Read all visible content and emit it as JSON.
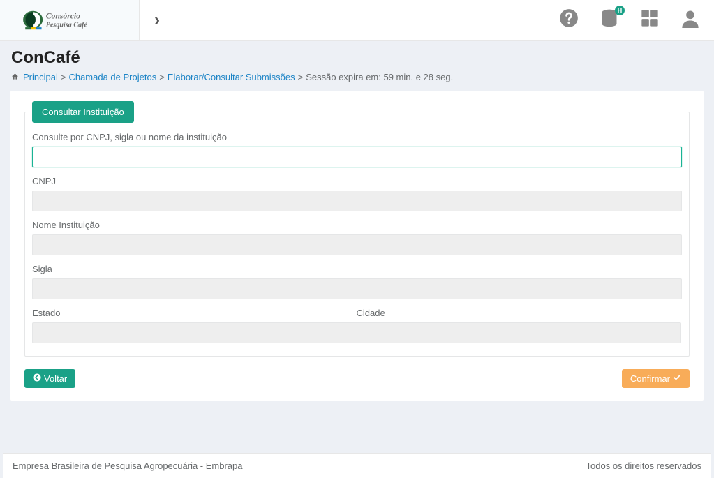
{
  "brand": {
    "line1": "Consórcio",
    "line2": "Pesquisa Café"
  },
  "topbar": {
    "help_icon": "help-circle-icon",
    "db_icon": "database-icon",
    "db_badge": "H",
    "grid_icon": "apps-grid-icon",
    "user_icon": "user-icon"
  },
  "page": {
    "title": "ConCafé"
  },
  "breadcrumb": {
    "principal": "Principal",
    "chamada": "Chamada de Projetos",
    "elaborar": "Elaborar/Consultar Submissões",
    "session": "Sessão expira em: 59 min. e 28 seg."
  },
  "form": {
    "legend": "Consultar Instituição",
    "search_label": "Consulte por CNPJ, sigla ou nome da instituição",
    "search_value": "",
    "cnpj_label": "CNPJ",
    "cnpj_value": "",
    "nome_label": "Nome Instituição",
    "nome_value": "",
    "sigla_label": "Sigla",
    "sigla_value": "",
    "estado_label": "Estado",
    "estado_value": "",
    "cidade_label": "Cidade",
    "cidade_value": ""
  },
  "buttons": {
    "voltar": "Voltar",
    "confirmar": "Confirmar"
  },
  "footer": {
    "left": "Empresa Brasileira de Pesquisa Agropecuária - Embrapa",
    "right": "Todos os direitos reservados"
  }
}
